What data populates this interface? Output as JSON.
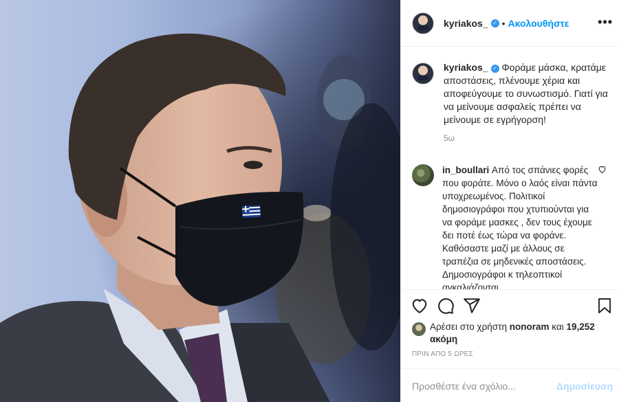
{
  "header": {
    "username": "kyriakos_",
    "separator": "•",
    "follow_label": "Ακολουθήστε",
    "more_label": "•••"
  },
  "caption": {
    "username": "kyriakos_",
    "text": "Φοράμε μάσκα, κρατάμε αποστάσεις, πλένουμε χέρια και αποφεύγουμε το συνωστισμό. Γιατί για να μείνουμε ασφαλείς πρέπει να μείνουμε σε εγρήγορση!",
    "time": "5ω"
  },
  "comments": [
    {
      "username": "in_boullari",
      "text": "Από τος σπάνιες φορές που φοράτε. Μόνο ο λαός είναι πάντα υποχρεωμένος. Πολιτικοί δημοσιογράφοι που χτυπιούνται για να φοράμε μασκες , δεν τους έχουμε δει ποτέ έως τώρα να φοράνε. Καθόσαστε μαζί με άλλους σε τραπέζια σε μηδενικές αποστάσεις. Δημοσιογράφοι κ τηλεοπτικοί αγκαλιάζονται ,"
    }
  ],
  "likes": {
    "prefix": "Αρέσει στο χρήστη",
    "user": "nonoram",
    "conj": "και",
    "count": "19,252 ακόμη"
  },
  "posted_ago": "ΠΡΙΝ ΑΠΟ 5 ΩΡΕΣ",
  "add_comment": {
    "placeholder": "Προσθέστε ένα σχόλιο...",
    "post_label": "Δημοσίευση"
  },
  "icons": [
    "heart-icon",
    "comment-icon",
    "share-icon",
    "bookmark-icon",
    "verified-icon",
    "more-icon"
  ],
  "colors": {
    "accent": "#0095f6",
    "post_disabled": "#b3dbff",
    "muted": "#8e8e8e"
  }
}
